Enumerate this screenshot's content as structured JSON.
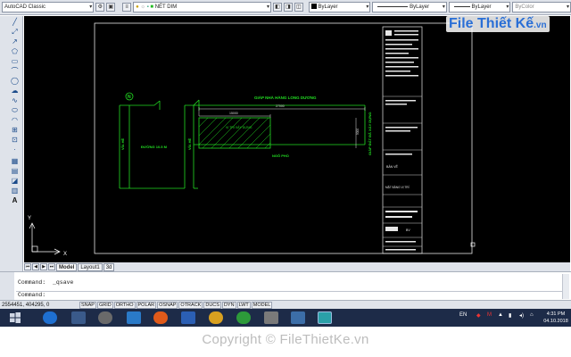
{
  "toolbar": {
    "workspace": "AutoCAD Classic",
    "layer": "NÉT DIM",
    "color": "ByLayer",
    "linetype": "ByLayer",
    "lineweight": "ByLayer",
    "plotstyle": "ByColor"
  },
  "drawing": {
    "title_top": "GIÁP NHÀ HÀNG LONG DƯƠNG",
    "label_left_road": "ĐƯỜNG 10.5 M",
    "label_left_side": "VỈA HÈ",
    "label_mid_side": "VỈA HÈ",
    "label_right": "GIÁP ĐẤT ĐÃ XÂY DỰNG",
    "label_bottom": "NGÕ PHỐ",
    "label_hatch": "VỊ TRÍ XÂY DỰNG",
    "dim_total": "27000",
    "dim_build": "15000",
    "dim_right": "5000",
    "north_mark": "N",
    "ucs_x": "X",
    "ucs_y": "Y",
    "titleblock": {
      "mid_label": "BẢN VẼ",
      "sheet_label": "MẶT BẰNG VỊ TRÍ",
      "bottom_label": "BV"
    }
  },
  "layout_tabs": [
    "Model",
    "Layout1",
    "3d"
  ],
  "command": {
    "line1": "Command:  _qsave",
    "line2": "Command:"
  },
  "status": {
    "coords": "2554451, 404295, 0",
    "buttons": [
      "SNAP",
      "GRID",
      "ORTHO",
      "POLAR",
      "OSNAP",
      "OTRACK",
      "DUCS",
      "DYN",
      "LWT",
      "MODEL"
    ]
  },
  "taskbar": {
    "lang": "EN",
    "time": "4:31 PM",
    "date": "04.10.2018"
  },
  "watermark": {
    "copyright": "Copyright © FileThietKe.vn",
    "logo_prefix": "File",
    "logo_main": "Thiết Kế",
    "logo_suffix": ".vn"
  },
  "colors": {
    "cad_green": "#22dd22",
    "canvas_bg": "#000000",
    "toolbar_bg": "#dfe3ea",
    "taskbar_bg": "#1d2b48"
  }
}
